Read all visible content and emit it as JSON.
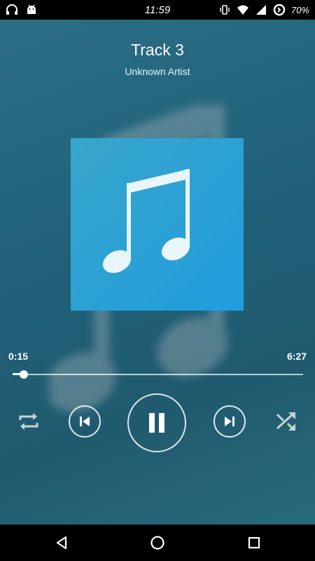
{
  "status_bar": {
    "time": "11:59",
    "battery_percent": "70%",
    "left_icons": [
      "headphones-icon",
      "android-icon"
    ],
    "right_icons": [
      "vibrate-icon",
      "wifi-icon",
      "signal-icon",
      "data-saver-icon"
    ]
  },
  "track": {
    "title": "Track 3",
    "artist": "Unknown Artist"
  },
  "playback": {
    "current_time": "0:15",
    "total_time": "6:27",
    "progress_fraction": 0.039
  },
  "controls": {
    "repeat": "repeat-icon",
    "previous": "skip-previous-icon",
    "play_pause": "pause-icon",
    "next": "skip-next-icon",
    "shuffle": "shuffle-icon"
  },
  "nav_bar": {
    "back": "back-icon",
    "home": "home-icon",
    "recents": "recents-icon"
  },
  "colors": {
    "background": "#22647a",
    "album_art": "#2aa0d6",
    "accent": "#ffffff"
  }
}
